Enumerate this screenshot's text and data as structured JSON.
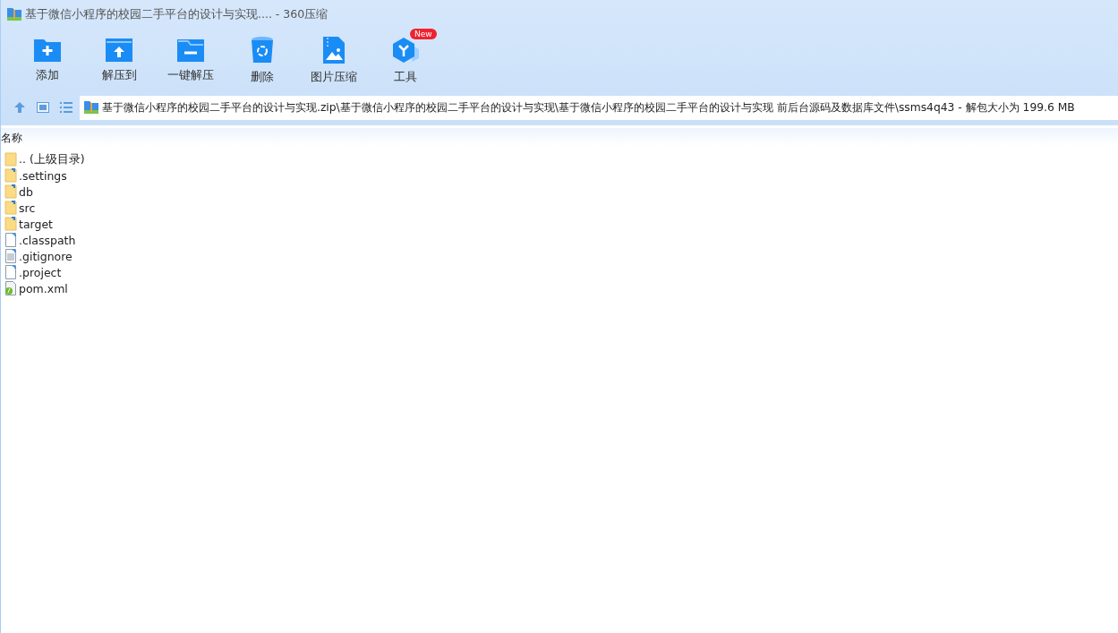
{
  "window": {
    "title": "基于微信小程序的校园二手平台的设计与实现.... - 360压缩"
  },
  "toolbar": [
    {
      "label": "添加",
      "kind": "add"
    },
    {
      "label": "解压到",
      "kind": "extract"
    },
    {
      "label": "一键解压",
      "kind": "oneclick"
    },
    {
      "label": "删除",
      "kind": "delete"
    },
    {
      "label": "图片压缩",
      "kind": "image"
    },
    {
      "label": "工具",
      "kind": "tools",
      "badge": "New"
    }
  ],
  "address_bar": {
    "value": "基于微信小程序的校园二手平台的设计与实现.zip\\基于微信小程序的校园二手平台的设计与实现\\基于微信小程序的校园二手平台的设计与实现 前后台源码及数据库文件\\ssms4q43 - 解包大小为 199.6 MB"
  },
  "file_list": {
    "columns": [
      "名称"
    ],
    "rows": [
      {
        "name": ".. (上级目录)",
        "kind": "parent"
      },
      {
        "name": ".settings",
        "kind": "folder"
      },
      {
        "name": "db",
        "kind": "folder"
      },
      {
        "name": "src",
        "kind": "folder"
      },
      {
        "name": "target",
        "kind": "folder"
      },
      {
        "name": ".classpath",
        "kind": "file"
      },
      {
        "name": ".gitignore",
        "kind": "text"
      },
      {
        "name": ".project",
        "kind": "file"
      },
      {
        "name": "pom.xml",
        "kind": "xml"
      }
    ]
  }
}
